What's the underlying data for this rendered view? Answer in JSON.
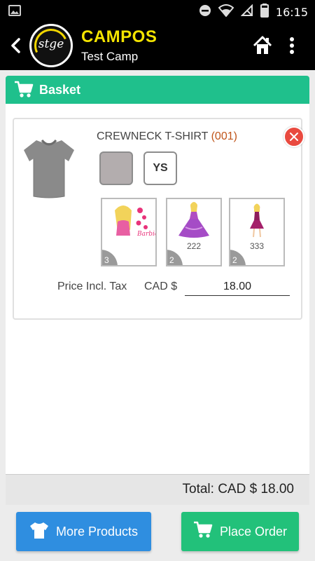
{
  "status_bar": {
    "time": "16:15",
    "icons": [
      "image-icon",
      "do-not-disturb-icon",
      "wifi-icon",
      "no-signal-icon",
      "battery-icon"
    ]
  },
  "app_bar": {
    "logo_text": "stge",
    "title": "CAMPOS",
    "subtitle": "Test Camp",
    "icons": [
      "back-arrow-icon",
      "home-icon",
      "more-vert-icon"
    ]
  },
  "basket": {
    "title": "Basket",
    "icon": "cart-icon"
  },
  "item": {
    "name": "CREWNECK T-SHIRT",
    "code": "(001)",
    "color": "#b3adae",
    "size": "YS",
    "designs": [
      {
        "label": "",
        "qty": "3",
        "name": "barbie-design"
      },
      {
        "label": "222",
        "qty": "2",
        "name": "princess-design"
      },
      {
        "label": "333",
        "qty": "2",
        "name": "doll-design"
      }
    ],
    "price_label": "Price Incl. Tax",
    "currency": "CAD $",
    "price": "18.00"
  },
  "total": {
    "text": "Total: CAD $ 18.00"
  },
  "footer": {
    "more_products": "More Products",
    "place_order": "Place Order"
  },
  "colors": {
    "accent_green": "#1fc08c",
    "brand_yellow": "#f4e400",
    "blue_button": "#2f8ee0",
    "green_button": "#22c17a",
    "remove_red": "#e94a3f"
  }
}
